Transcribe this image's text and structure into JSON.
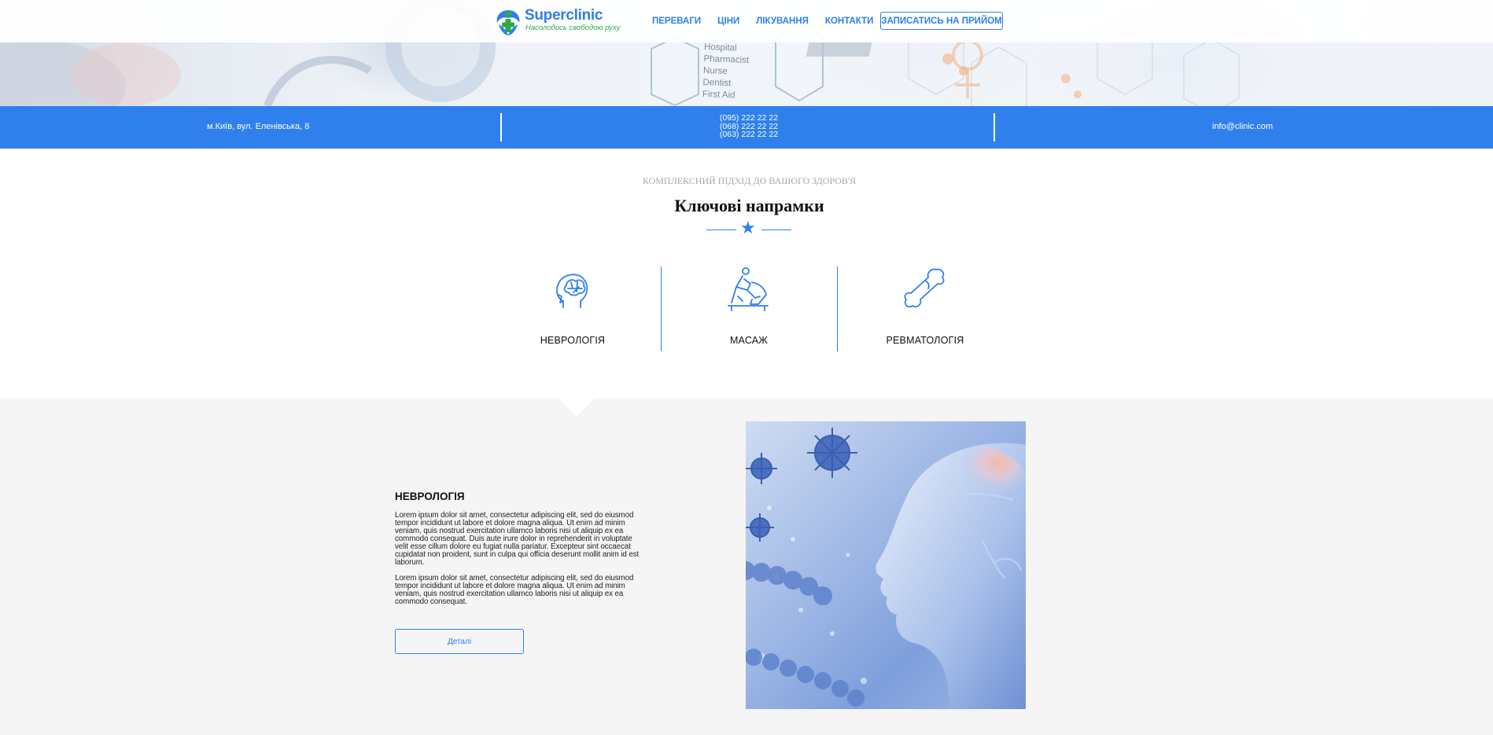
{
  "header": {
    "logo": {
      "name": "Superclinic",
      "tagline": "Насолодись свободою руху"
    },
    "nav": [
      {
        "label": "ПЕРЕВАГИ"
      },
      {
        "label": "ЦІНИ"
      },
      {
        "label": "ЛІКУВАННЯ"
      },
      {
        "label": "КОНТАКТИ"
      }
    ],
    "cta_label": "ЗАПИСАТИСЬ НА ПРИЙОМ"
  },
  "hero": {
    "notes": [
      "Hospital",
      "Pharmacist",
      "Nurse",
      "Dentist",
      "First Aid"
    ]
  },
  "contacts": {
    "address": "м.Київ, вул. Еленівська, 8",
    "phones": [
      "(095) 222 22 22",
      "(068) 222 22 22",
      "(063) 222 22 22"
    ],
    "email": "info@clinic.com"
  },
  "directions": {
    "eyebrow": "КОМПЛЕКСНИЙ ПІДХІД ДО ВАШОГО ЗДОРОВ'Я",
    "title": "Ключові напрамки",
    "items": [
      {
        "label": "НЕВРОЛОГІЯ",
        "icon": "brain-head-icon"
      },
      {
        "label": "МАСАЖ",
        "icon": "massage-icon"
      },
      {
        "label": "РЕВМАТОЛОГІЯ",
        "icon": "bone-icon"
      }
    ]
  },
  "detail": {
    "title": "НЕВРОЛОГІЯ",
    "paragraphs": [
      "Lorem ipsum dolor sit amet, consectetur adipiscing elit, sed do eiusmod tempor incididunt ut labore et dolore magna aliqua. Ut enim ad minim veniam, quis nostrud exercitation ullamco laboris nisi ut aliquip ex ea commodo consequat. Duis aute irure dolor in reprehenderit in voluptate velit esse cillum dolore eu fugiat nulla pariatur. Excepteur sint occaecat cupidatat non proident, sunt in culpa qui officia deserunt mollit anim id est laborum.",
      "Lorem ipsum dolor sit amet, consectetur adipiscing elit, sed do eiusmod tempor incididunt ut labore et dolore magna aliqua. Ut enim ad minim veniam, quis nostrud exercitation ullamco laboris nisi ut aliquip ex ea commodo consequat."
    ],
    "button_label": "Деталі"
  },
  "colors": {
    "accent": "#2f80ec",
    "brand_green": "#2fa84a",
    "section_bg": "#f5f5f5"
  }
}
